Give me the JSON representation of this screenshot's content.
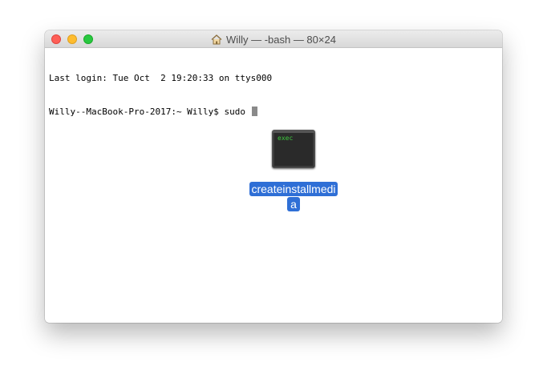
{
  "window": {
    "title": "Willy — -bash — 80×24",
    "title_icon": "home-icon",
    "traffic_lights": {
      "close": "#fe5f57",
      "minimize": "#febc2e",
      "zoom": "#28c840"
    }
  },
  "terminal": {
    "lines": [
      "Last login: Tue Oct  2 19:20:33 on ttys000",
      "Willy--MacBook-Pro-2017:~ Willy$ sudo "
    ]
  },
  "drag": {
    "icon_label": "exec",
    "file_name_line1": "createinstallmedi",
    "file_name_line2": "a",
    "accent": "#2f6fd6"
  }
}
